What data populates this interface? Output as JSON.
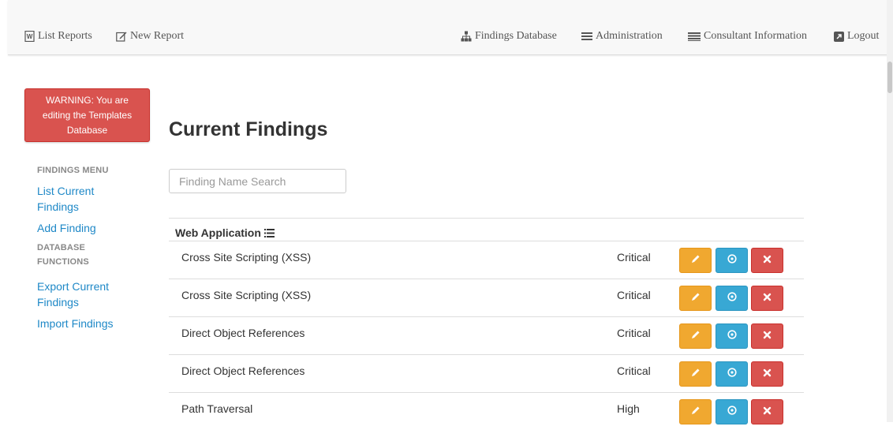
{
  "navbar": {
    "list_reports": "List Reports",
    "new_report": "New Report",
    "findings_database": "Findings Database",
    "administration": "Administration",
    "consultant_information": "Consultant Information",
    "logout": "Logout",
    "icons": [
      "document-icon",
      "edit-icon",
      "sitemap-icon",
      "menu-icon",
      "list-icon",
      "logout-icon"
    ]
  },
  "warning": {
    "line1": "WARNING: You are",
    "line2": "editing the Templates",
    "line3": "Database"
  },
  "sidebar": {
    "findings_menu": "FINDINGS MENU",
    "list_current_line1": "List Current",
    "list_current_line2": "Findings",
    "add_finding": "Add Finding",
    "database_line1": "DATABASE",
    "database_line2": "FUNCTIONS",
    "export_line1": "Export Current",
    "export_line2": "Findings",
    "import_findings": "Import Findings"
  },
  "main": {
    "title": "Current Findings",
    "search_placeholder": "Finding Name Search",
    "category": "Web Application",
    "findings": [
      {
        "name": "Cross Site Scripting (XSS)",
        "severity": "Critical"
      },
      {
        "name": "Cross Site Scripting (XSS)",
        "severity": "Critical"
      },
      {
        "name": "Direct Object References",
        "severity": "Critical"
      },
      {
        "name": "Direct Object References",
        "severity": "Critical"
      },
      {
        "name": "Path Traversal",
        "severity": "High"
      }
    ]
  },
  "colors": {
    "warning_red": "#d9534f",
    "link_blue": "#1e88c7",
    "edit_orange": "#f0a830",
    "view_blue": "#38a8d4",
    "delete_red": "#d9534f"
  }
}
